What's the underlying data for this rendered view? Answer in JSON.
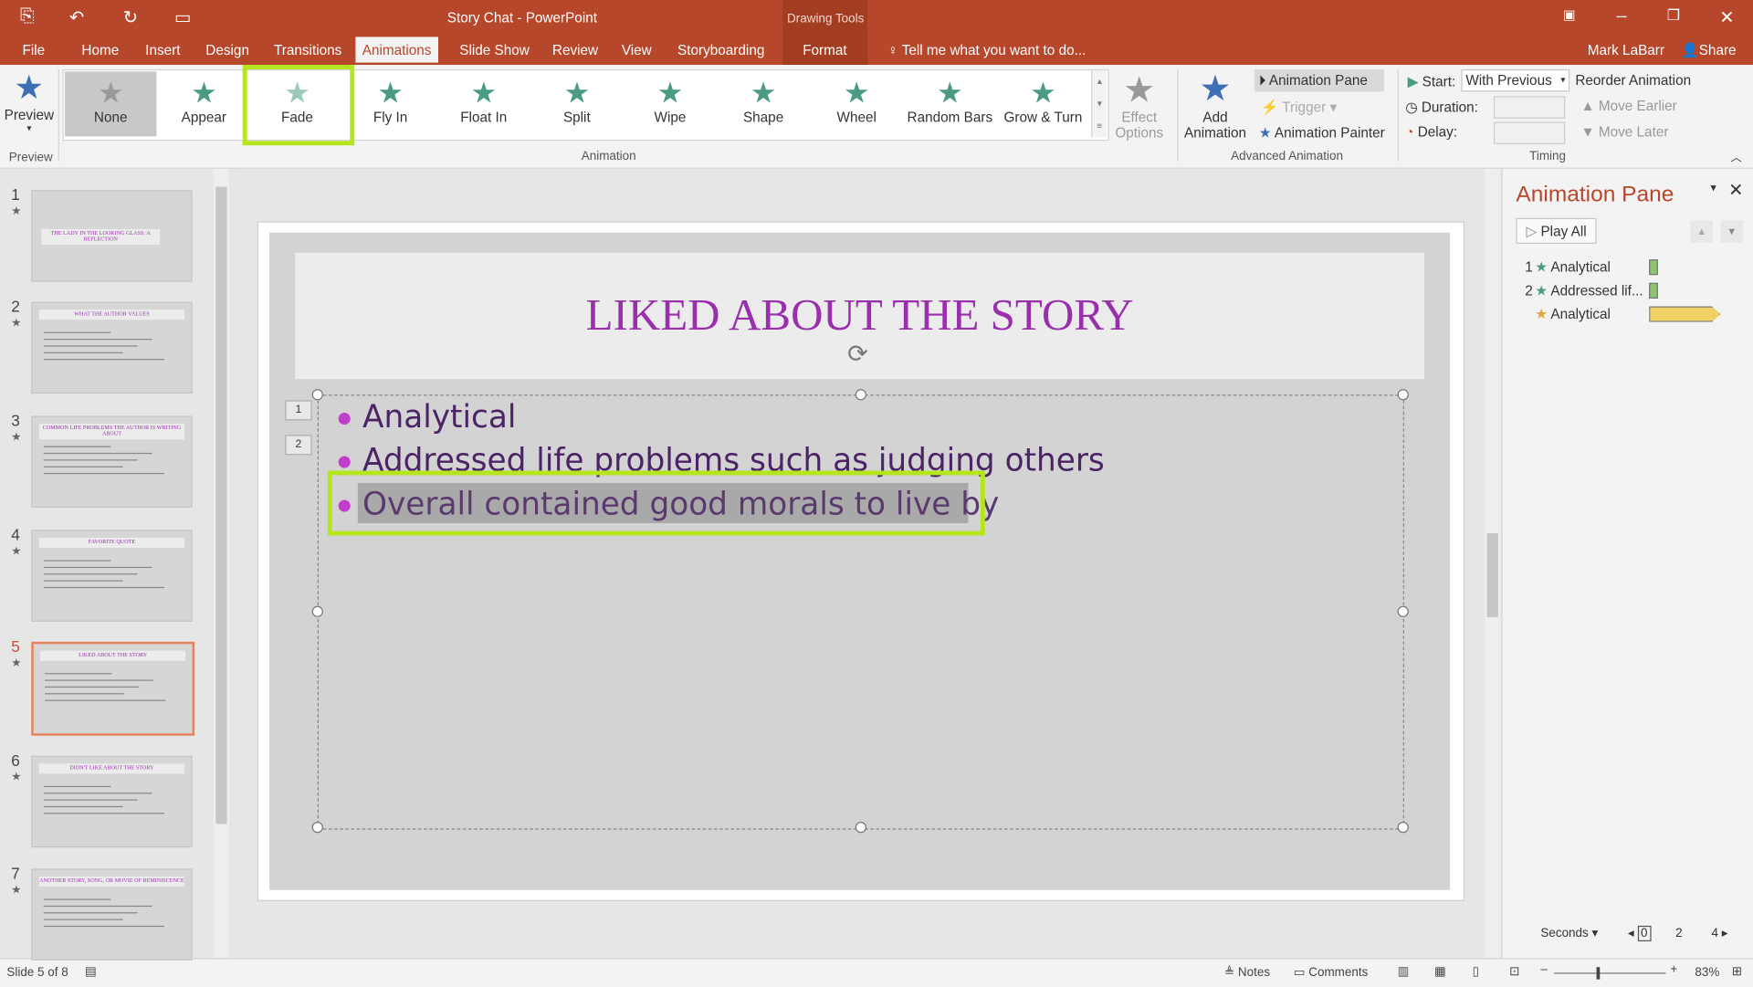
{
  "window": {
    "title": "Story Chat - PowerPoint",
    "contextual": "Drawing Tools",
    "user": "Mark LaBarr",
    "share": "Share"
  },
  "tabs": [
    "File",
    "Home",
    "Insert",
    "Design",
    "Transitions",
    "Animations",
    "Slide Show",
    "Review",
    "View",
    "Storyboarding",
    "Format"
  ],
  "tell_me": "Tell me what you want to do...",
  "ribbon": {
    "preview": "Preview",
    "preview_group": "Preview",
    "effects": [
      "None",
      "Appear",
      "Fade",
      "Fly In",
      "Float In",
      "Split",
      "Wipe",
      "Shape",
      "Wheel",
      "Random Bars",
      "Grow & Turn"
    ],
    "effect_options": "Effect Options",
    "animation_group": "Animation",
    "add_animation": "Add Animation",
    "animation_pane": "Animation Pane",
    "trigger": "Trigger",
    "animation_painter": "Animation Painter",
    "advanced_group": "Advanced Animation",
    "start_label": "Start:",
    "start_value": "With Previous",
    "duration_label": "Duration:",
    "delay_label": "Delay:",
    "timing_group": "Timing",
    "reorder": "Reorder Animation",
    "move_earlier": "Move Earlier",
    "move_later": "Move Later"
  },
  "thumbnails": [
    {
      "n": "1",
      "title": "THE LADY IN THE LOOKING GLASS: A REFLECTION"
    },
    {
      "n": "2",
      "title": "WHAT THE AUTHOR VALUES"
    },
    {
      "n": "3",
      "title": "COMMON LIFE PROBLEMS THE AUTHOR IS WRITING ABOUT"
    },
    {
      "n": "4",
      "title": "FAVORITE QUOTE"
    },
    {
      "n": "5",
      "title": "LIKED ABOUT THE STORY"
    },
    {
      "n": "6",
      "title": "DIDN'T LIKE ABOUT THE STORY"
    },
    {
      "n": "7",
      "title": "ANOTHER STORY, SONG, OR MOVIE OF REMINISCENCE"
    }
  ],
  "slide": {
    "title": "LIKED ABOUT THE STORY",
    "bullets": [
      "Analytical",
      "Addressed life problems such as judging others",
      "Overall contained good morals to live by"
    ],
    "tags": [
      "1",
      "2"
    ]
  },
  "pane": {
    "title": "Animation Pane",
    "play_all": "Play All",
    "items": [
      {
        "n": "1",
        "label": "Analytical"
      },
      {
        "n": "2",
        "label": "Addressed lif..."
      },
      {
        "n": "",
        "label": "Analytical"
      }
    ],
    "seconds": "Seconds",
    "scale": [
      "0",
      "2",
      "4"
    ]
  },
  "status": {
    "slide": "Slide 5 of 8",
    "notes": "Notes",
    "comments": "Comments",
    "zoom": "83%"
  },
  "colors": {
    "accent": "#b7472a",
    "title": "#9a2fae",
    "highlight": "#b5e61d"
  }
}
